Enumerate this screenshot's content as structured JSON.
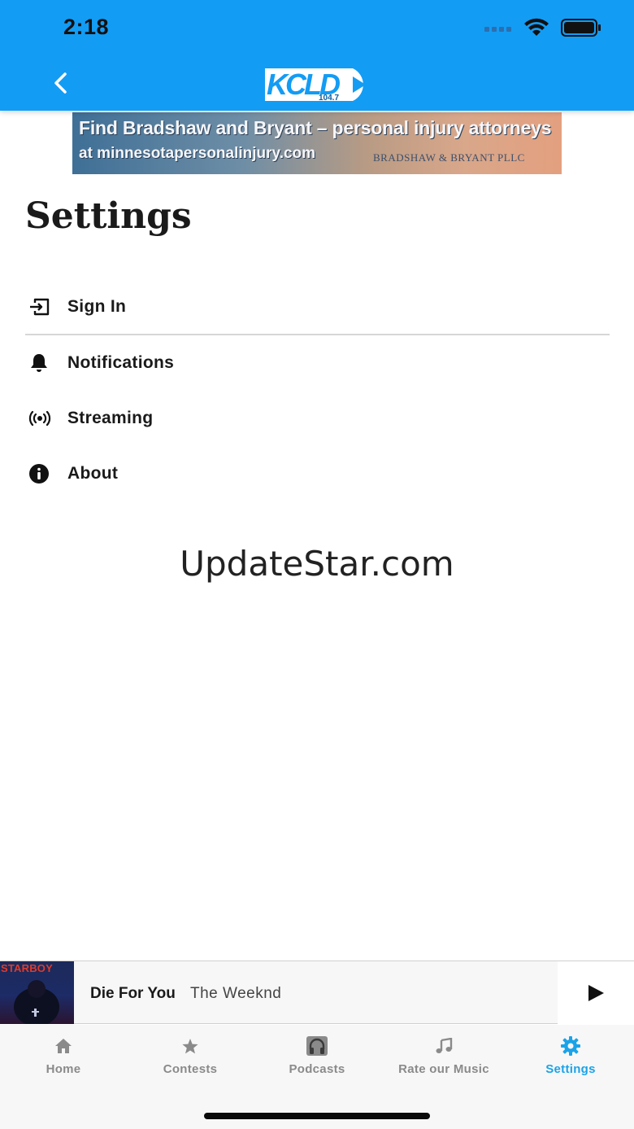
{
  "status_bar": {
    "time": "2:18"
  },
  "header": {
    "logo_text": "KCLD",
    "logo_frequency": "104.7",
    "accent_color": "#139cf4"
  },
  "ad": {
    "line1": "Find Bradshaw and Bryant – personal injury attorneys",
    "line2": "at minnesotapersonalinjury.com",
    "brand": "BRADSHAW & BRYANT PLLC"
  },
  "page": {
    "title": "Settings"
  },
  "settings": {
    "items": [
      {
        "label": "Sign In",
        "icon": "sign-in-icon"
      },
      {
        "label": "Notifications",
        "icon": "bell-icon"
      },
      {
        "label": "Streaming",
        "icon": "broadcast-icon"
      },
      {
        "label": "About",
        "icon": "info-icon"
      }
    ]
  },
  "watermark": "UpdateStar.com",
  "now_playing": {
    "album_art_text": "STARBOY",
    "title": "Die For You",
    "artist": "The Weeknd"
  },
  "tabs": [
    {
      "label": "Home",
      "icon": "home-icon",
      "active": false
    },
    {
      "label": "Contests",
      "icon": "star-icon",
      "active": false
    },
    {
      "label": "Podcasts",
      "icon": "headphones-icon",
      "active": false
    },
    {
      "label": "Rate our Music",
      "icon": "music-note-icon",
      "active": false
    },
    {
      "label": "Settings",
      "icon": "gear-icon",
      "active": true
    }
  ],
  "colors": {
    "tab_active": "#1aa3e8",
    "tab_inactive": "#8a8a8a"
  }
}
